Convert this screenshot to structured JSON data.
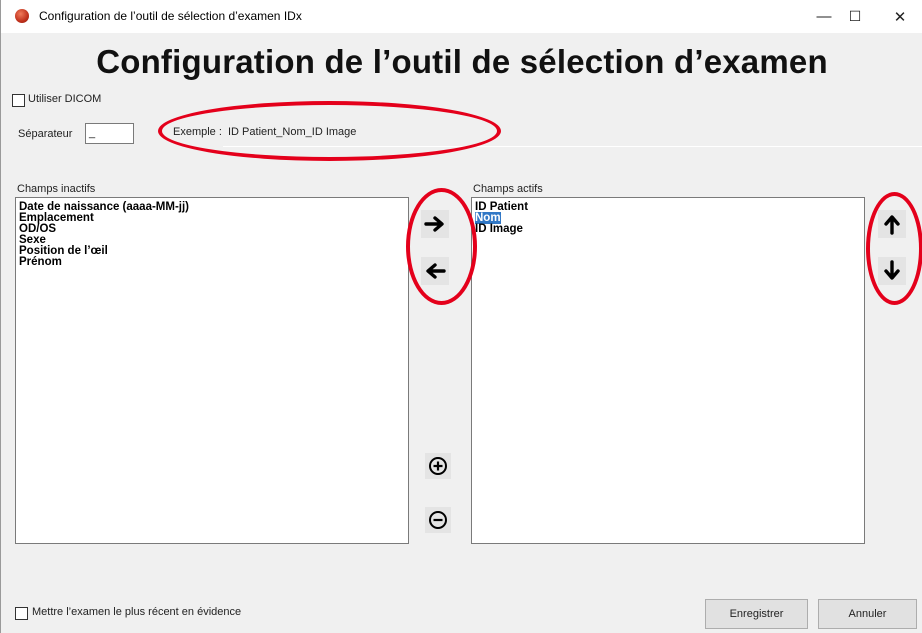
{
  "window": {
    "title": "Configuration de l’outil de sélection d’examen IDx",
    "minimize_glyph": "—",
    "maximize_glyph": "☐",
    "close_glyph": "✕"
  },
  "heading": "Configuration de l’outil de sélection d’examen",
  "dicom": {
    "label": "Utiliser DICOM",
    "checked": false
  },
  "separator": {
    "label": "Séparateur",
    "value": "_"
  },
  "example": {
    "label": "Exemple :",
    "value": "ID Patient_Nom_ID Image"
  },
  "inactive": {
    "label": "Champs inactifs",
    "items": [
      "Date de naissance (aaaa-MM-jj)",
      "Emplacement",
      "OD/OS",
      "Sexe",
      "Position de l’œil",
      "Prénom"
    ]
  },
  "active": {
    "label": "Champs actifs",
    "items": [
      "ID Patient",
      "Nom",
      "ID Image"
    ],
    "selected": "Nom"
  },
  "footer": {
    "highlight_label": "Mettre l’examen le plus récent en évidence",
    "highlight_checked": false,
    "save_label": "Enregistrer",
    "cancel_label": "Annuler"
  },
  "colors": {
    "annotation": "#e4001b",
    "selection": "#3178c6"
  }
}
